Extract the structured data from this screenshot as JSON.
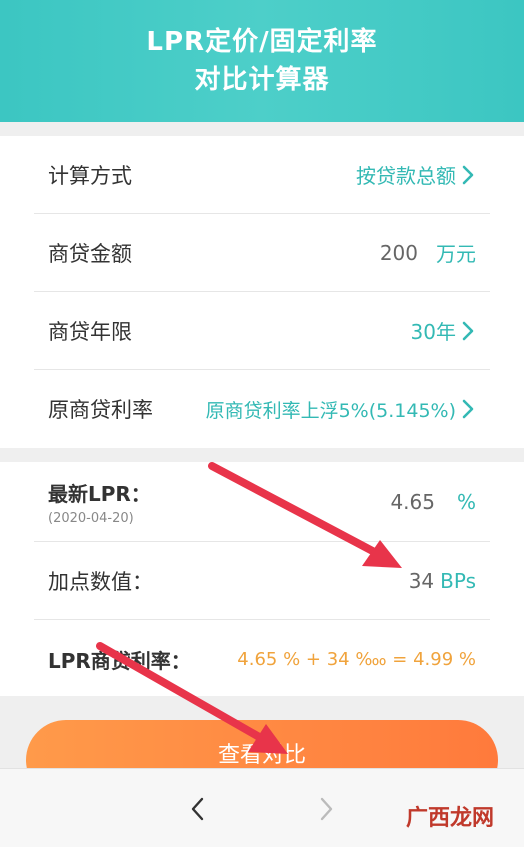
{
  "header": {
    "title_line1": "LPR定价/固定利率",
    "title_line2": "对比计算器"
  },
  "rows": [
    {
      "label": "计算方式",
      "value": "按贷款总额"
    },
    {
      "label": "商贷金额",
      "value": "200",
      "unit": "万元"
    },
    {
      "label": "商贷年限",
      "value": "30年"
    },
    {
      "label": "原商贷利率",
      "value": "原商贷利率上浮5%(5.145%)"
    }
  ],
  "lpr": {
    "latest_label": "最新LPR：",
    "latest_date": "(2020-04-20)",
    "latest_value": "4.65",
    "latest_unit": "%",
    "bp_label": "加点数值：",
    "bp_value": "34",
    "bp_unit": "BPs",
    "rate_label": "LPR商贷利率：",
    "rate_formula": "4.65 % + 34 ‱ = 4.99 %"
  },
  "button": {
    "label": "查看对比"
  },
  "watermark": "广西龙网",
  "colors": {
    "teal": "#33b9b4",
    "orange": "#f0a33c",
    "arrow": "#e8344a"
  }
}
